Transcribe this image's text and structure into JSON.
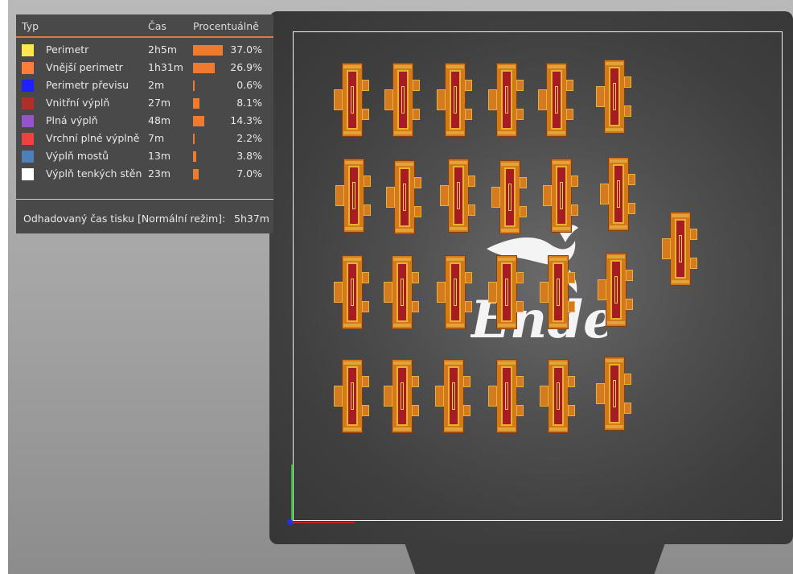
{
  "legend": {
    "headers": {
      "type": "Typ",
      "time": "Čas",
      "percent": "Procentuálně"
    },
    "rows": [
      {
        "name": "Perimetr",
        "time": "2h5m",
        "percent": "37.0%",
        "value": 37.0,
        "color": "#ffe64d"
      },
      {
        "name": "Vnější perimetr",
        "time": "1h31m",
        "percent": "26.9%",
        "value": 26.9,
        "color": "#ff7d38"
      },
      {
        "name": "Perimetr převisu",
        "time": "2m",
        "percent": "0.6%",
        "value": 0.6,
        "color": "#1f1fff"
      },
      {
        "name": "Vnitřní výplň",
        "time": "27m",
        "percent": "8.1%",
        "value": 8.1,
        "color": "#b03029"
      },
      {
        "name": "Plná výplň",
        "time": "48m",
        "percent": "14.3%",
        "value": 14.3,
        "color": "#9654cc"
      },
      {
        "name": "Vrchní plné výplně",
        "time": "7m",
        "percent": "2.2%",
        "value": 2.2,
        "color": "#f04040"
      },
      {
        "name": "Výplň mostů",
        "time": "13m",
        "percent": "3.8%",
        "value": 3.8,
        "color": "#4d80ba"
      },
      {
        "name": "Výplň tenkých stěn",
        "time": "23m",
        "percent": "7.0%",
        "value": 7.0,
        "color": "#ffffff"
      }
    ],
    "estimate_label": "Odhadovaný čas tisku [Normální režim]:",
    "estimate_value": "5h37m"
  },
  "colors": {
    "accent_line": "#e07a3b",
    "bar": "#f07a2e",
    "panel_bg": "#494949"
  }
}
